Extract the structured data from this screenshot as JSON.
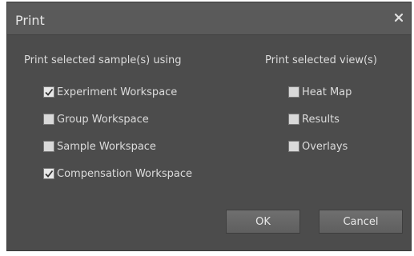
{
  "dialog": {
    "title": "Print",
    "close_icon": "close-icon"
  },
  "samples": {
    "label": "Print selected sample(s) using",
    "options": [
      {
        "label": "Experiment Workspace",
        "checked": true
      },
      {
        "label": "Group Workspace",
        "checked": false
      },
      {
        "label": "Sample Workspace",
        "checked": false
      },
      {
        "label": "Compensation Workspace",
        "checked": true
      }
    ]
  },
  "views": {
    "label": "Print selected view(s)",
    "options": [
      {
        "label": "Heat Map",
        "checked": false
      },
      {
        "label": "Results",
        "checked": false
      },
      {
        "label": "Overlays",
        "checked": false
      }
    ]
  },
  "buttons": {
    "ok_label": "OK",
    "cancel_label": "Cancel"
  }
}
